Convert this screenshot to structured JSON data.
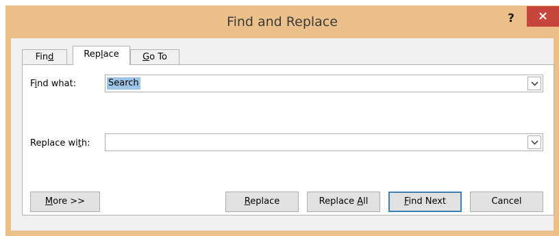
{
  "window": {
    "title": "Find and Replace",
    "help_glyph": "?",
    "close_glyph": "×"
  },
  "tabs": [
    {
      "label": "Find",
      "mnemonic_index": 3,
      "active": false
    },
    {
      "label": "Replace",
      "mnemonic_index": 3,
      "active": true
    },
    {
      "label": "Go To",
      "mnemonic_index": 0,
      "active": false
    }
  ],
  "fields": {
    "find": {
      "label": "Find what:",
      "mnemonic_index": 1,
      "value": "Search",
      "selected": true
    },
    "replace": {
      "label": "Replace with:",
      "mnemonic_index": 10,
      "value": ""
    }
  },
  "buttons": {
    "more": {
      "label": "More >>",
      "mnemonic_index": 0
    },
    "replace": {
      "label": "Replace",
      "mnemonic_index": 0
    },
    "replace_all": {
      "label": "Replace All",
      "mnemonic_index": 8
    },
    "find_next": {
      "label": "Find Next",
      "mnemonic_index": 0
    },
    "cancel": {
      "label": "Cancel",
      "mnemonic_index": -1
    }
  },
  "colors": {
    "frame": "#ecc08a",
    "close_button": "#c7453c",
    "selection": "#9dc3e6",
    "default_button_border": "#3c7fb1"
  }
}
